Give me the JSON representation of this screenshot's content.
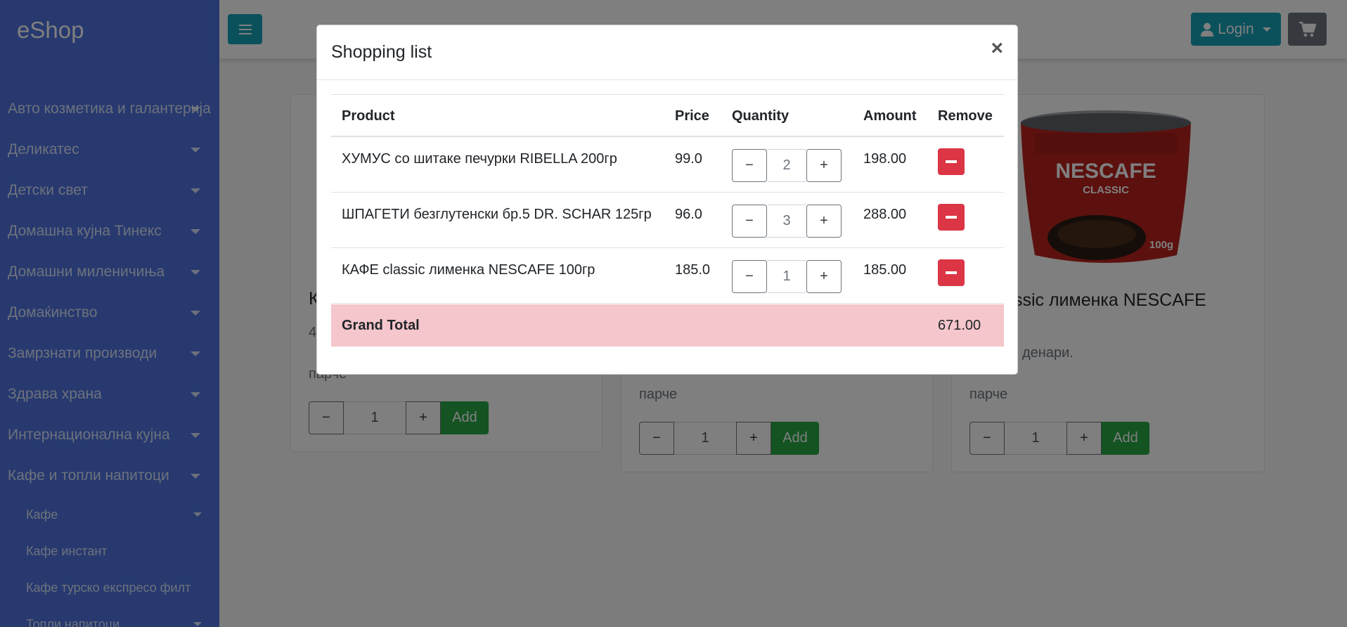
{
  "brand": "eShop",
  "sidebar": {
    "items": [
      {
        "label": "Авто козметика и галантерија"
      },
      {
        "label": "Деликатес"
      },
      {
        "label": "Детски свет"
      },
      {
        "label": "Домашна кујна Тинекс"
      },
      {
        "label": "Домашни миленичиња"
      },
      {
        "label": "Домаќинство"
      },
      {
        "label": "Замрзнати производи"
      },
      {
        "label": "Здрава храна"
      },
      {
        "label": "Интернационална кујна"
      },
      {
        "label": "Кафе и топли напитоци"
      }
    ],
    "subitems": [
      {
        "label": "Кафе"
      },
      {
        "label": "Кафе инстант"
      },
      {
        "label": "Кафе турско експресо филт"
      },
      {
        "label": "Топли напитоци"
      }
    ]
  },
  "topbar": {
    "login_label": "Login",
    "menu_icon": "bars-icon",
    "cart_icon": "cart-icon",
    "user_icon": "user-icon"
  },
  "cards": [
    {
      "title": "К",
      "price": "4",
      "unit": "парче",
      "qty": "1",
      "minus": "−",
      "plus": "+",
      "add_label": "Add"
    },
    {
      "title": "",
      "price": "",
      "unit": "парче",
      "qty": "1",
      "minus": "−",
      "plus": "+",
      "add_label": "Add"
    },
    {
      "title": "classic лименка NESCAFE",
      "price": "денари.",
      "unit": "парче",
      "qty": "1",
      "minus": "−",
      "plus": "+",
      "add_label": "Add",
      "image_brand": "NESCAFE",
      "image_sub": "CLASSIC",
      "image_size": "100g"
    }
  ],
  "modal": {
    "title": "Shopping list",
    "close": "×",
    "headers": {
      "product": "Product",
      "price": "Price",
      "quantity": "Quantity",
      "amount": "Amount",
      "remove": "Remove"
    },
    "rows": [
      {
        "product": "ХУМУС со шитаке печурки RIBELLA 200гр",
        "price": "99.0",
        "qty": "2",
        "amount": "198.00"
      },
      {
        "product": "ШПАГЕТИ безглутенски бр.5 DR. SCHAR 125гр",
        "price": "96.0",
        "qty": "3",
        "amount": "288.00"
      },
      {
        "product": "КАФЕ classic лименка NESCAFE 100гр",
        "price": "185.0",
        "qty": "1",
        "amount": "185.00"
      }
    ],
    "minus": "−",
    "plus": "+",
    "grand_label": "Grand Total",
    "grand_value": "671.00"
  },
  "colors": {
    "sidebar": "#4e73df",
    "info": "#17a2b8",
    "success": "#28a745",
    "danger": "#dc3545",
    "grand_total_bg": "#f5c6cb"
  }
}
